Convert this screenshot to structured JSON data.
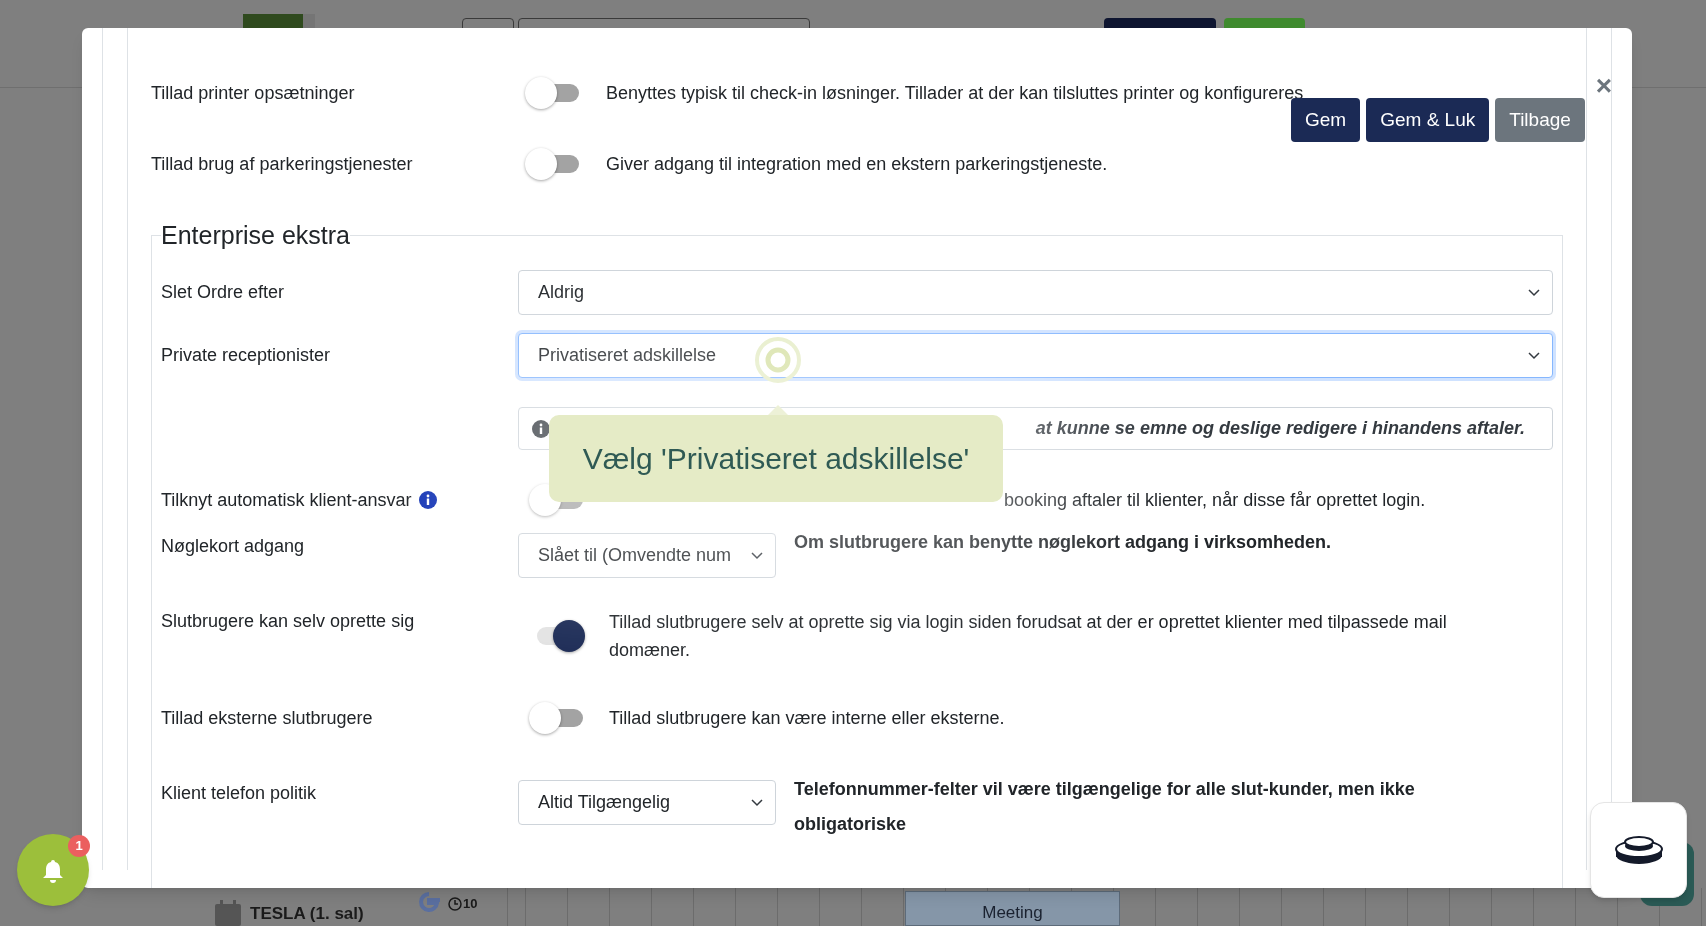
{
  "close_label": "×",
  "actions": [
    {
      "label": "Gem",
      "kind": "primary"
    },
    {
      "label": "Gem & Luk",
      "kind": "primary"
    },
    {
      "label": "Tilbage",
      "kind": "secondary"
    }
  ],
  "top_settings": [
    {
      "label": "Tillad printer opsætninger",
      "on": false,
      "description": "Benyttes typisk til check-in løsninger. Tillader at der kan tilsluttes printer og konfigureres"
    },
    {
      "label": "Tillad brug af parkeringstjenester",
      "on": false,
      "description": "Giver adgang til integration med en ekstern parkeringstjeneste."
    }
  ],
  "section": {
    "title": "Enterprise ekstra",
    "rows": [
      {
        "kind": "select",
        "label": "Slet Ordre efter",
        "value": "Aldrig",
        "focused": false
      },
      {
        "kind": "select",
        "label": "Private receptionister",
        "value": "Privatiseret adskillelse",
        "focused": true
      },
      {
        "kind": "note",
        "text": "at kunne se emne og deslige redigere i hinandens aftaler."
      },
      {
        "kind": "toggle",
        "label": "Tilknyt automatisk klient-ansvar",
        "info_icon": true,
        "on": false,
        "description": "booking aftaler til klienter, når disse får oprettet login."
      },
      {
        "kind": "select_note",
        "label": "Nøglekort adgang",
        "value": "Slået til (Omvendte num",
        "focused": false,
        "note": "Om slutbrugere kan benytte nøglekort adgang i virksomheden."
      },
      {
        "kind": "toggle",
        "label": "Slutbrugere kan selv oprette sig",
        "info_icon": false,
        "on": true,
        "description": "Tillad slutbrugere selv at oprette sig via login siden forudsat at der er oprettet klienter med tilpassede mail domæner."
      },
      {
        "kind": "toggle",
        "label": "Tillad eksterne slutbrugere",
        "info_icon": false,
        "on": false,
        "description": "Tillad slutbrugere kan være interne eller eksterne."
      },
      {
        "kind": "select_note",
        "label": "Klient telefon politik",
        "value": "Altid Tilgængelig",
        "focused": false,
        "note": "Telefonnummer-felter vil være tilgængelige for alle slut-kunder, men ikke obligatoriske"
      }
    ]
  },
  "tooltip": {
    "text": "Vælg 'Privatiseret adskillelse'"
  },
  "notifications": {
    "count": "1"
  },
  "background": {
    "room": "TESLA (1. sal)",
    "duration": "10",
    "event": "Meeting"
  }
}
